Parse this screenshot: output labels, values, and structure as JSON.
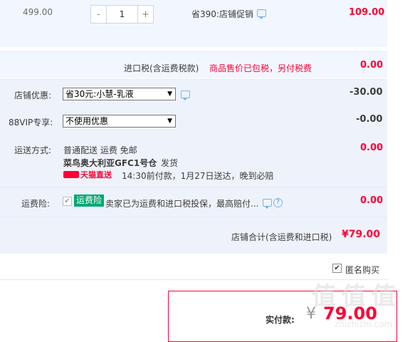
{
  "item": {
    "unit_price": "499.00",
    "quantity": "1",
    "minus": "-",
    "plus": "+",
    "promo_text": "省390:店铺促销",
    "subtotal": "109.00"
  },
  "tax": {
    "label": "进口税(含运费税款)",
    "note": "商品售价已包税，另付税费",
    "value": "0.00"
  },
  "shop_discount": {
    "label": "店铺优惠:",
    "selected": "省30元:小慧-乳液",
    "value": "-30.00"
  },
  "vip": {
    "label": "88VIP专享:",
    "selected": "不使用优惠",
    "value": "-0.00"
  },
  "shipping": {
    "label": "运送方式:",
    "method": "普通配送 运费 免邮",
    "warehouse": "菜鸟奥大利亚GFC1号仓",
    "ship_word": "发货",
    "badge": "天猫直送",
    "eta": "14:30前付款，1月27日送达，晚到必赔",
    "value": "0.00"
  },
  "insurance": {
    "label": "运费险:",
    "badge": "运费险",
    "text": "卖家已为运费和进口税投保，最高赔付...",
    "value": "0.00"
  },
  "shop_total": {
    "label": "店铺合计(含运费和进口税)",
    "value": "¥79.00"
  },
  "anonymous": {
    "label": "匿名购买",
    "checked": true
  },
  "final": {
    "label": "实付款:",
    "currency": "¥",
    "amount": "79.00"
  },
  "watermark": {
    "text": "值 值 值",
    "sub": "zhizhizhi.com"
  },
  "colors": {
    "accent": "#ff0036",
    "panel": "#f2f7ff",
    "badge_green": "#00a870"
  }
}
